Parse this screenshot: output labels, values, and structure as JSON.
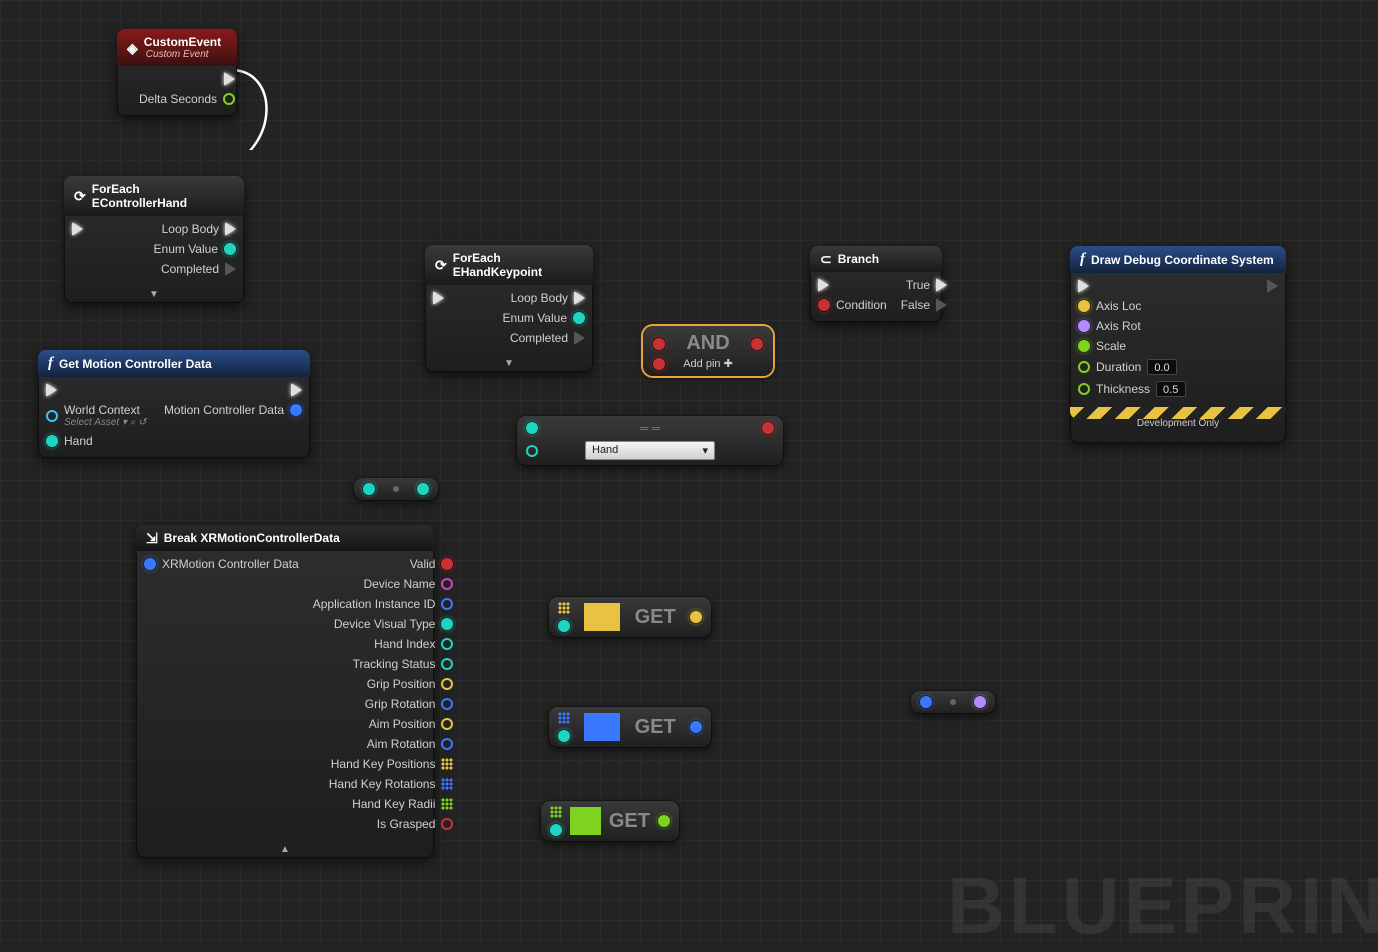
{
  "watermark": "BLUEPRIN",
  "nodes": {
    "customEvent": {
      "title": "CustomEvent",
      "subtitle": "Custom Event",
      "pins": {
        "deltaSeconds": "Delta Seconds"
      }
    },
    "forEachHand": {
      "title": "ForEach EControllerHand",
      "pins": {
        "loopBody": "Loop Body",
        "enumValue": "Enum Value",
        "completed": "Completed"
      }
    },
    "getMotion": {
      "title": "Get Motion Controller Data",
      "pins": {
        "worldContext": "World Context",
        "selectAsset": "Select Asset",
        "hand": "Hand",
        "motionControllerData": "Motion Controller Data"
      }
    },
    "forEachKeypoint": {
      "title": "ForEach EHandKeypoint",
      "pins": {
        "loopBody": "Loop Body",
        "enumValue": "Enum Value",
        "completed": "Completed"
      }
    },
    "branch": {
      "title": "Branch",
      "pins": {
        "condition": "Condition",
        "true": "True",
        "false": "False"
      }
    },
    "drawDebug": {
      "title": "Draw Debug Coordinate System",
      "dev": "Development Only",
      "pins": {
        "axisLoc": "Axis Loc",
        "axisRot": "Axis Rot",
        "scale": "Scale",
        "duration": "Duration",
        "durationVal": "0.0",
        "thickness": "Thickness",
        "thicknessVal": "0.5"
      }
    },
    "and": {
      "title": "AND",
      "addPin": "Add pin"
    },
    "equal": {
      "selectValue": "Hand"
    },
    "breakXR": {
      "title": "Break XRMotionControllerData",
      "pins": {
        "input": "XRMotion Controller Data",
        "valid": "Valid",
        "deviceName": "Device Name",
        "appId": "Application Instance ID",
        "deviceVisualType": "Device Visual Type",
        "handIndex": "Hand Index",
        "trackingStatus": "Tracking Status",
        "gripPosition": "Grip Position",
        "gripRotation": "Grip Rotation",
        "aimPosition": "Aim Position",
        "aimRotation": "Aim Rotation",
        "handKeyPositions": "Hand Key Positions",
        "handKeyRotations": "Hand Key Rotations",
        "handKeyRadii": "Hand Key Radii",
        "isGrasped": "Is Grasped"
      }
    },
    "get": {
      "title": "GET"
    }
  }
}
